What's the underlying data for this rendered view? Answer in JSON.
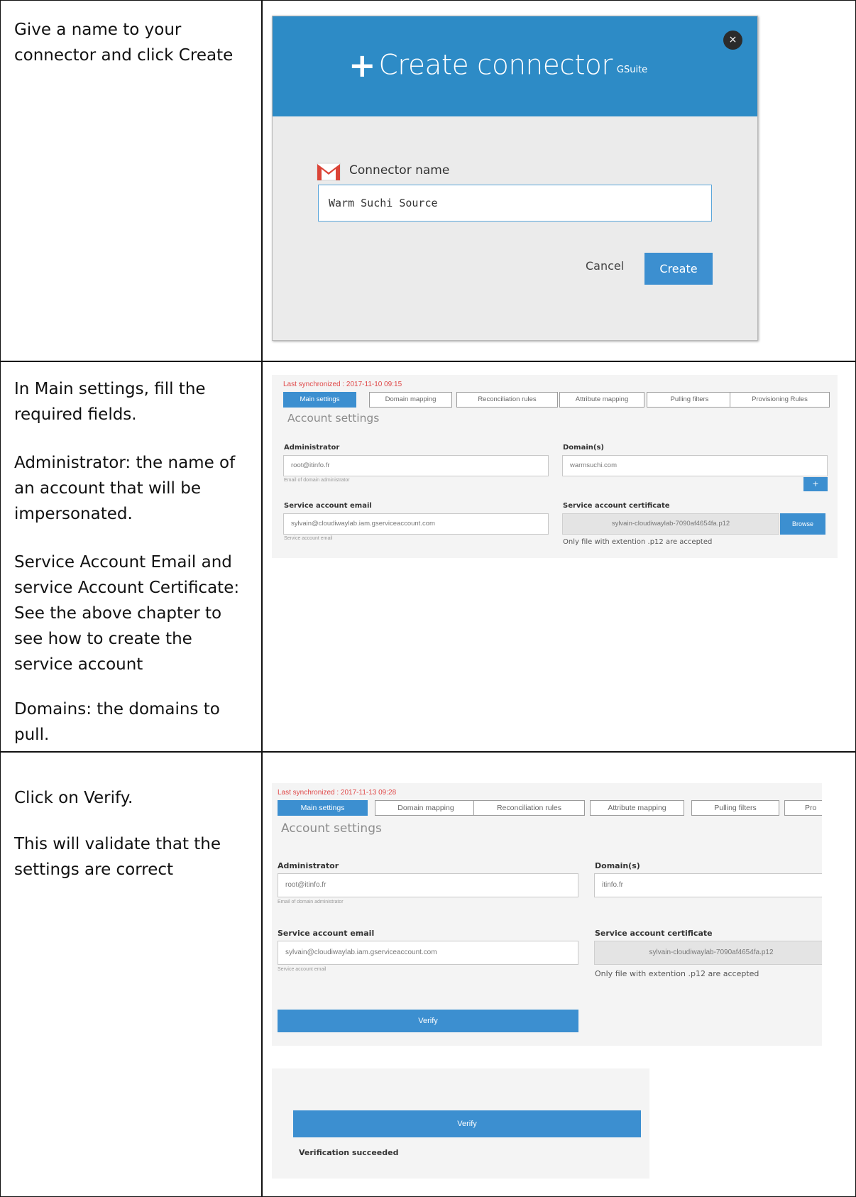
{
  "rows": [
    {
      "instruction": [
        "Give a name to your connector and click Create"
      ]
    },
    {
      "instruction": [
        "In Main settings, fill the required fields.",
        "Administrator: the name of an account that will be impersonated.",
        "Service Account Email and service Account Certificate: See the above chapter to see how to create the service account",
        "Domains: the domains to pull."
      ]
    },
    {
      "instruction": [
        "Click on Verify.",
        "This will validate that the settings are correct"
      ]
    }
  ],
  "dialog": {
    "title": "Create connector",
    "subtitle": "GSuite",
    "close_icon": "×",
    "connector_label": "Connector name",
    "connector_value": "Warm Suchi Source",
    "cancel_label": "Cancel",
    "create_label": "Create",
    "header_color": "#2d8bc6",
    "accent_color": "#3c8fd0"
  },
  "settings1": {
    "last_sync": "Last synchronized : 2017-11-10 09:15",
    "tabs": [
      "Main settings",
      "Domain mapping",
      "Reconciliation rules",
      "Attribute mapping",
      "Pulling filters",
      "Provisioning Rules"
    ],
    "account_title": "Account settings",
    "admin_label": "Administrator",
    "admin_value": "root@itinfo.fr",
    "admin_hint": "Email of domain administrator",
    "domains_label": "Domain(s)",
    "domains_value": "warmsuchi.com",
    "add_icon": "+",
    "sa_email_label": "Service account email",
    "sa_email_value": "sylvain@cloudiwaylab.iam.gserviceaccount.com",
    "sa_email_hint": "Service account email",
    "cert_label": "Service account certificate",
    "cert_value": "sylvain-cloudiwaylab-7090af4654fa.p12",
    "browse_label": "Browse",
    "cert_note": "Only file with extention .p12 are accepted"
  },
  "settings2": {
    "last_sync": "Last synchronized : 2017-11-13 09:28",
    "tabs": [
      "Main settings",
      "Domain mapping",
      "Reconciliation rules",
      "Attribute mapping",
      "Pulling filters",
      "Pro"
    ],
    "account_title": "Account settings",
    "admin_label": "Administrator",
    "admin_value": "root@itinfo.fr",
    "admin_hint": "Email of domain administrator",
    "domains_label": "Domain(s)",
    "domains_value": "itinfo.fr",
    "sa_email_label": "Service account email",
    "sa_email_value": "sylvain@cloudiwaylab.iam.gserviceaccount.com",
    "sa_email_hint": "Service account email",
    "cert_label": "Service account certificate",
    "cert_value": "sylvain-cloudiwaylab-7090af4654fa.p12",
    "cert_note": "Only file with extention .p12 are accepted",
    "verify_label": "Verify"
  },
  "verify_result": {
    "verify_label": "Verify",
    "message": "Verification succeeded"
  }
}
